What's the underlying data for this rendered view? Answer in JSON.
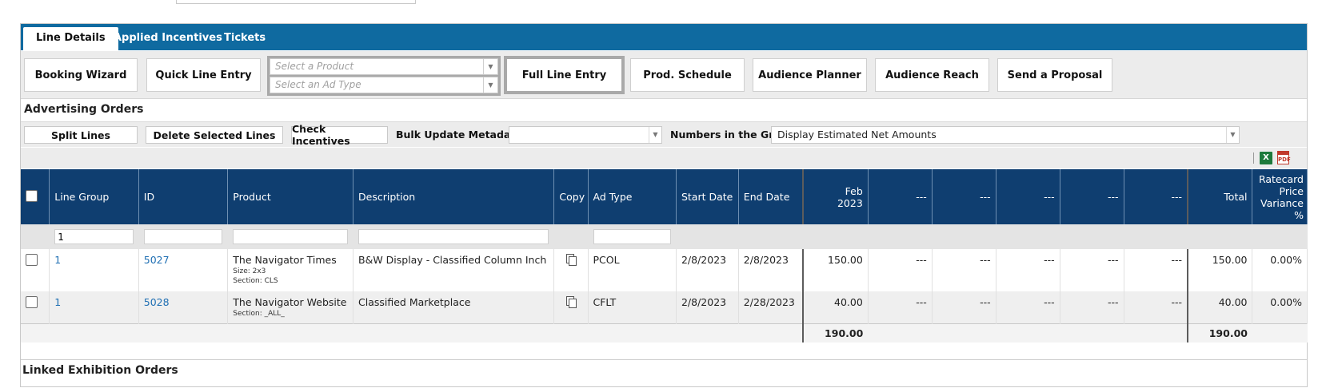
{
  "tabs": [
    "Line Details",
    "Applied Incentives",
    "Tickets"
  ],
  "toolbar": {
    "booking_wizard": "Booking Wizard",
    "quick_line_entry": "Quick Line Entry",
    "product_placeholder": "Select a Product",
    "adtype_placeholder": "Select an Ad Type",
    "full_line_entry": "Full Line Entry",
    "prod_schedule": "Prod. Schedule",
    "audience_planner": "Audience Planner",
    "audience_reach": "Audience Reach",
    "send_proposal": "Send a Proposal"
  },
  "section_title": "Advertising Orders",
  "actions": {
    "split_lines": "Split Lines",
    "delete_selected": "Delete Selected Lines",
    "check_incentives": "Check Incentives",
    "bulk_update_label": "Bulk Update Metadata",
    "bulk_update_value": "",
    "numbers_label": "Numbers in the Grid",
    "numbers_value": "Display Estimated Net Amounts"
  },
  "columns": {
    "line_group": "Line Group",
    "id": "ID",
    "product": "Product",
    "description": "Description",
    "copy": "Copy",
    "ad_type": "Ad Type",
    "start_date": "Start Date",
    "end_date": "End Date",
    "month1_a": "Feb",
    "month1_b": "2023",
    "dash": "---",
    "total": "Total",
    "variance_a": "Ratecard",
    "variance_b": "Price",
    "variance_c": "Variance",
    "variance_d": "%"
  },
  "filters": {
    "line_group": "1",
    "id": "",
    "product": "",
    "description": "",
    "ad_type": ""
  },
  "rows": [
    {
      "line_group": "1",
      "id": "5027",
      "product": "The Navigator Times",
      "meta1": "Size: 2x3",
      "meta2": "Section: CLS",
      "description": "B&W Display - Classified Column Inch",
      "ad_type": "PCOL",
      "start": "2/8/2023",
      "end": "2/8/2023",
      "feb": "150.00",
      "dash": "---",
      "total": "150.00",
      "variance": "0.00%"
    },
    {
      "line_group": "1",
      "id": "5028",
      "product": "The Navigator Website",
      "meta1": "Section: _ALL_",
      "description": "Classified Marketplace",
      "ad_type": "CFLT",
      "start": "2/8/2023",
      "end": "2/28/2023",
      "feb": "40.00",
      "dash": "---",
      "total": "40.00",
      "variance": "0.00%"
    }
  ],
  "totals": {
    "feb": "190.00",
    "total": "190.00"
  },
  "next_section": "Linked Exhibition Orders"
}
